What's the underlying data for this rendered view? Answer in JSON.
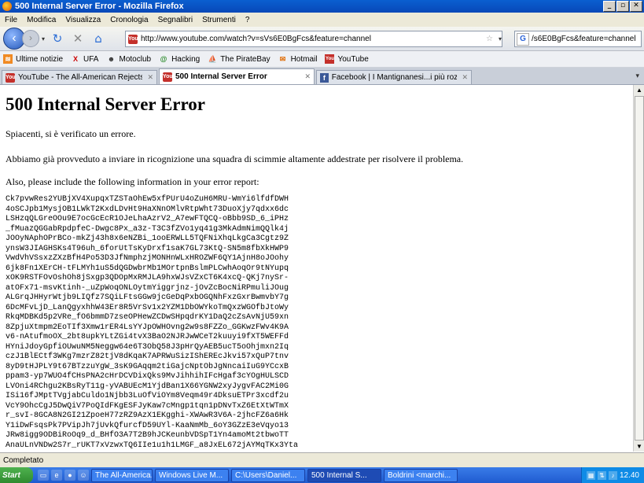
{
  "window": {
    "title": "500 Internal Server Error - Mozilla Firefox"
  },
  "menu": [
    "File",
    "Modifica",
    "Visualizza",
    "Cronologia",
    "Segnalibri",
    "Strumenti",
    "?"
  ],
  "address": {
    "url": "http://www.youtube.com/watch?v=sVs6E0BgFcs&feature=channel"
  },
  "search": {
    "value": "/s6E0BgFcs&feature=channel",
    "engine_letter": "G"
  },
  "bookmarks": [
    {
      "label": "Ultime notizie",
      "icon": "rss-icon"
    },
    {
      "label": "UFA",
      "icon": "ufa-icon"
    },
    {
      "label": "Motoclub",
      "icon": "motoclub-icon"
    },
    {
      "label": "Hacking",
      "icon": "hacking-icon"
    },
    {
      "label": "The PirateBay",
      "icon": "piratebay-icon"
    },
    {
      "label": "Hotmail",
      "icon": "hotmail-icon"
    },
    {
      "label": "YouTube",
      "icon": "youtube-icon"
    }
  ],
  "tabs": [
    {
      "label": "YouTube - The All-American Rejects - T...",
      "active": false
    },
    {
      "label": "500 Internal Server Error",
      "active": true
    },
    {
      "label": "Facebook | I Mantignanesi...i più rozzi ...",
      "active": false
    }
  ],
  "page": {
    "heading": "500 Internal Server Error",
    "line1": "Spiacenti, si è verificato un errore.",
    "line2": "Abbiamo già provveduto a inviare in ricognizione una squadra di scimmie altamente addestrate per risolvere il problema.",
    "line3": "Also, please include the following information in your error report:",
    "code_lines": [
      "Ck7pvwRes2YUBjXV4XupqxTZSTaOhEw5xfPUrU4oZuH6MRU-WmYi6lfdfDWH",
      "4oSCJpb1MysjOB1LWkT2KxdLDvHt9HaXNnOMlvRtpWht73DuoXjy7qdxx6dc",
      "LSHzqQLGreOOu9E7ocGcEcR1OJeLhaAzrV2_A7ewFTQCQ-oBbb9SD_6_iPHz",
      "_fMuazQGGabRpdpfeC-Dwgc8Px_a3z-T3C3fZVo1yq41g3MkAdmNimQQlk4j",
      "JOOyNAphOPrBCo-mkZj43h8x6eNZBi_1ooERWLL5TQFNiXhqLkgCa3Cgtz9Z",
      "ynsW3JIAGHSKs4T96uh_6forUtTsKyDrxf1saK7GL73KtQ-SN5m8fbXkHWP9",
      "VwdVhVSsxzZXzBfH4Po53D3JfNmphzjMONHnWLxHROZWF6QY1AjnH8oJOohy",
      "6jk8Fn1XErCH-tFLMYh1uS5dQGDwbrMb1MOrtpnBslmPLCwhAoqOr9tNYupq",
      "xOK9RSTFOvOshOh8jSxgp3QDOpMxRMJLA9hxWJsVZxCT6K4xcQ-QKj7nySr-",
      "atOFx71-msvKtinh-_uZpWoqONLOytmYiggrjnz-jOvZcBocNiRPmuliJOug",
      "ALGrqJHHyrWtjb9LIQfz7SQiLFtsGGw9jcGeDqPxbOGQNhFxzGxrBwmvbY7g",
      "6DcMFvLjD_LanQgyxhhW43Er8R5VrSv1x2YZM1DbOWYkoTmQxzWGOfbJtoWy",
      "RkqMDBKd5p2VRe_fO6bmmD7zseOPHewZCDwSHpqdrKY1DaQ2cZsAvNjU59xn",
      "8ZpjuXtmpm2EoTIf3Xmw1rER4LsYYJpOWHOvng2w9s8FZZo_GGKwzFWv4K9A",
      "v6-nAtufmoOX_2bt8upkYLtZGi4tvX3BaO2NJRJwWCeT2kuuyi9fXT5WEFFd",
      "HYniJdoyGpfiOUwuNM5Neggw64e6T3ObQ58J3pHrQyAEB5ucT5oOhjmxn2Iq",
      "czJ1BlECtf3WKg7mzrZ82tjV8dKqaK7APRWuSizIShEREcJkvi57xQuP7tnv",
      "8yD9tHJPLY9t67BTzzuYgW_3sK9GAqqm2tiGajcNptObJgNncaiIuG9YCcxB",
      "ppam3-yp7WUO4fCHsPNA2cHrDCVDixQks9MvJihhihIFcHgaf3cYOgHULSCD",
      "LVOni4RChgu2KBsRyT11g-yVABUEcM1YjdBan1X66YGNW2xyJygvFAC2Mi0G",
      "ISi16fJMptTVgjabCuldo1Njbb3LuOfViOYm8Veqm49r4DksuETPr3xcdf2u",
      "VcY9OhcCgJ5DwQiV7PoQIdFKgESFJyKaw7cMngp1tqn1pDNvTxZ6EtXtWTmX",
      "r_svI-8GCA8N2GI21ZpoeH77zRZ9AzX1EKgghi-XWAwR3V6A-2jhcFZ6a6Hk",
      "Y1iDwFsqsPk7PVipJh7jUvkQfurcfD59UYl-KaaNmMb_6oY3GZzE3eVqyo13",
      "JRw8igg9ODBiRoOq9_d_BHfO3A7T2B9hJCKeunbVDSpT1Yn4amoMt2tbwoTT",
      "AnaULnVNDw2S7r_rUKT7xVzwxTQ6IIe1u1h1LMGF_a8JxEL672jAYMqTKx3Yta"
    ]
  },
  "status": {
    "text": "Completato"
  },
  "taskbar": {
    "start": "Start",
    "tasks": [
      {
        "label": "The All-America...",
        "active": false
      },
      {
        "label": "Windows Live M...",
        "active": false
      },
      {
        "label": "C:\\Users\\Daniel...",
        "active": false
      },
      {
        "label": "500 Internal S...",
        "active": true
      },
      {
        "label": "Boldrini <marchi...",
        "active": false
      }
    ],
    "clock": "12.40"
  },
  "colors": {
    "titlebar": "#0848b8",
    "taskbar": "#1f5bd0",
    "tray": "#0f8be6",
    "start": "#2f8a2f"
  }
}
